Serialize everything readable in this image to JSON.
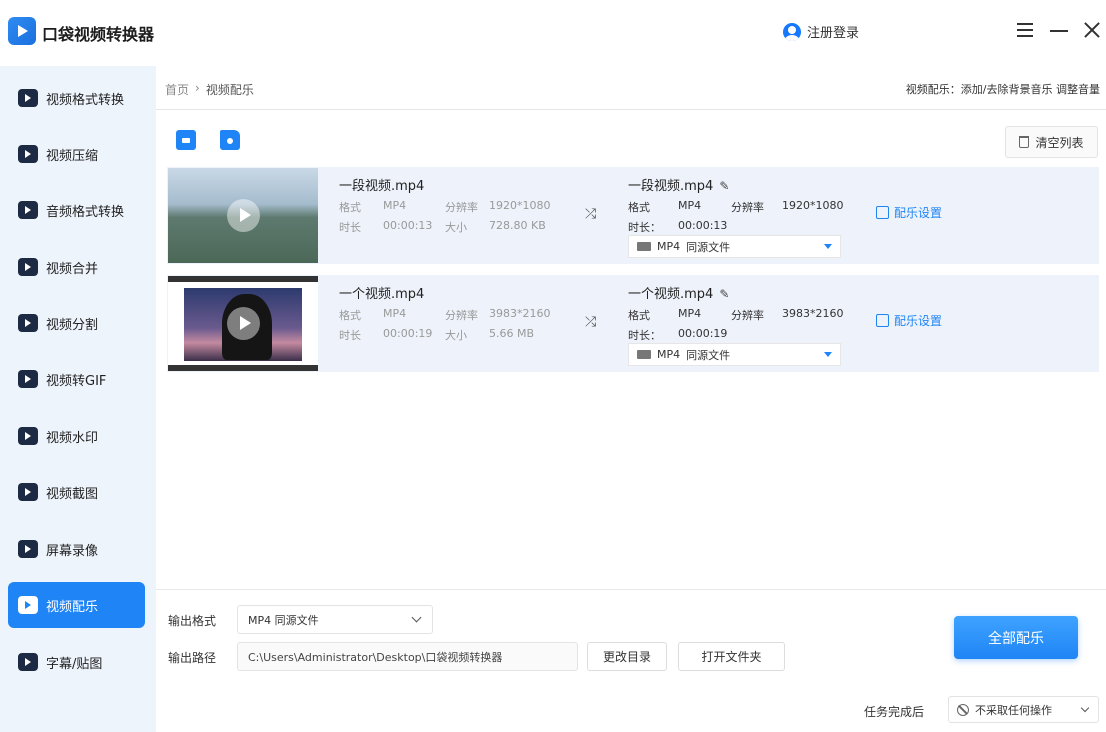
{
  "app": {
    "title": "口袋视频转换器",
    "login": "注册登录"
  },
  "sidebar": {
    "items": [
      {
        "label": "视频格式转换"
      },
      {
        "label": "视频压缩"
      },
      {
        "label": "音频格式转换"
      },
      {
        "label": "视频合并"
      },
      {
        "label": "视频分割"
      },
      {
        "label": "视频转GIF"
      },
      {
        "label": "视频水印"
      },
      {
        "label": "视频截图"
      },
      {
        "label": "屏幕录像"
      },
      {
        "label": "视频配乐"
      },
      {
        "label": "字幕/贴图"
      }
    ],
    "active_index": 9
  },
  "header": {
    "breadcrumb_home": "首页",
    "breadcrumb_sep": "›",
    "breadcrumb_current": "视频配乐",
    "tip": "视频配乐：添加/去除背景音乐 调整音量"
  },
  "toolbar": {
    "clear_label": "清空列表"
  },
  "labels": {
    "format": "格式",
    "resolution": "分辨率",
    "duration": "时长",
    "size": "大小",
    "duration_colon": "时长：",
    "music_settings": "配乐设置"
  },
  "files": [
    {
      "name": "一段视频.mp4",
      "format": "MP4",
      "resolution": "1920*1080",
      "duration": "00:00:13",
      "size": "728.80 KB",
      "out_name": "一段视频.mp4",
      "out_format": "MP4",
      "out_resolution": "1920*1080",
      "out_duration": "00:00:13",
      "select_format": "MP4",
      "select_option": "同源文件"
    },
    {
      "name": "一个视频.mp4",
      "format": "MP4",
      "resolution": "3983*2160",
      "duration": "00:00:19",
      "size": "5.66 MB",
      "out_name": "一个视频.mp4",
      "out_format": "MP4",
      "out_resolution": "3983*2160",
      "out_duration": "00:00:19",
      "select_format": "MP4",
      "select_option": "同源文件"
    }
  ],
  "bottom": {
    "output_format_label": "输出格式",
    "output_format_value": "MP4 同源文件",
    "output_path_label": "输出路径",
    "output_path_value": "C:\\Users\\Administrator\\Desktop\\口袋视频转换器",
    "change_dir": "更改目录",
    "open_folder": "打开文件夹",
    "start_all": "全部配乐",
    "after_label": "任务完成后",
    "after_value": "不采取任何操作"
  },
  "colors": {
    "accent": "#1f84f5",
    "sidebar_bg": "#eef4fc",
    "row_bg": "#eef3fb"
  }
}
